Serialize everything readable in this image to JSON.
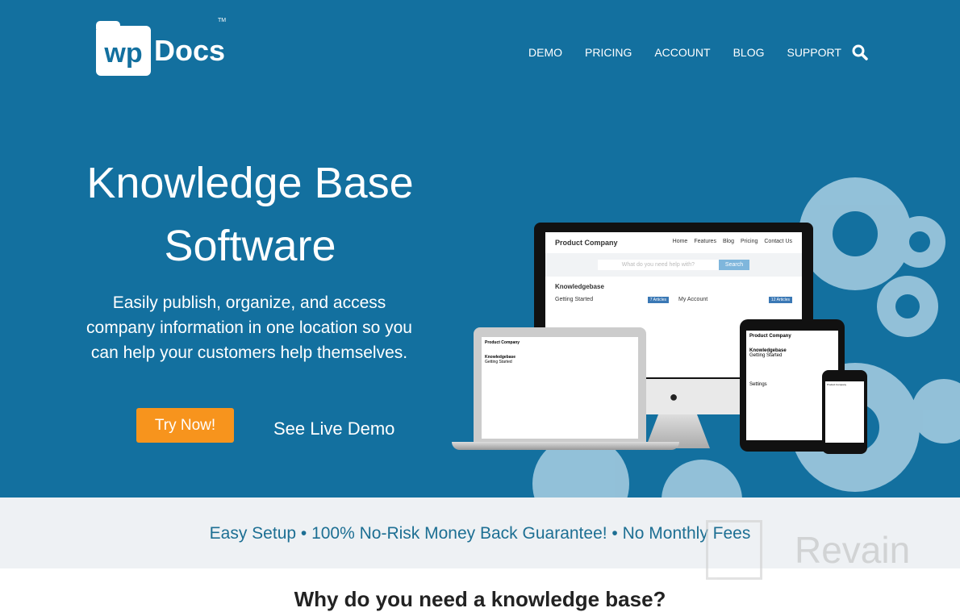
{
  "header": {
    "logo_wp": "wp",
    "logo_docs": "Docs",
    "logo_tm": "TM",
    "nav": [
      "DEMO",
      "PRICING",
      "ACCOUNT",
      "BLOG",
      "SUPPORT"
    ]
  },
  "hero": {
    "title_line1": "Knowledge Base",
    "title_line2": "Software",
    "subtitle": "Easily publish, organize, and access company information in one location so you can help your customers help themselves.",
    "try_label": "Try Now!",
    "demo_label": "See Live Demo"
  },
  "mockup": {
    "company": "Product Company",
    "nav": [
      "Home",
      "Features",
      "Blog",
      "Pricing",
      "Contact Us"
    ],
    "search_placeholder": "What do you need help with?",
    "search_button": "Search",
    "kb": "Knowledgebase",
    "cat1": "Getting Started",
    "cat1_badge": "7 Articles",
    "cat2": "My Account",
    "cat2_badge": "12 Articles",
    "settings": "Settings"
  },
  "band": {
    "text": "Easy Setup • 100% No-Risk Money Back Guarantee! • No Monthly Fees"
  },
  "section": {
    "heading": "Why do you need a knowledge base?"
  },
  "watermark": "Revain",
  "colors": {
    "hero_bg": "#13709f",
    "cta": "#f7941d",
    "band_bg": "#eef1f4",
    "band_text": "#1d6f93"
  }
}
